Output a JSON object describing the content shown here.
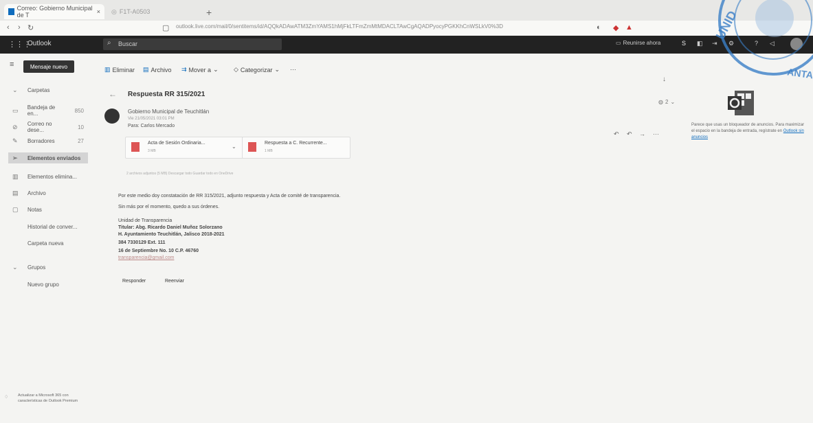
{
  "browser": {
    "tab1_title": "Correo: Gobierno Municipal de T",
    "tab2_title": "F1T-A0503",
    "url": "outlook.live.com/mail/0/sentitems/id/AQQkADAwATM3ZmYAMS1hMjFkLTFmZmMtMDACLTAwCgAQADPyocyPGKKhCnWSLkV0%3D"
  },
  "outlook": {
    "title": "Outlook",
    "search_placeholder": "Buscar",
    "meeting_label": "Reunirse ahora"
  },
  "toolbar": {
    "new_message": "Mensaje nuevo",
    "delete": "Eliminar",
    "archive": "Archivo",
    "move_to": "Mover a",
    "categorize": "Categorizar"
  },
  "sidebar": {
    "folders_header": "Carpetas",
    "items": [
      {
        "label": "Bandeja de en...",
        "count": "850"
      },
      {
        "label": "Correo no dese...",
        "count": "10"
      },
      {
        "label": "Borradores",
        "count": "27"
      },
      {
        "label": "Elementos enviados",
        "count": ""
      },
      {
        "label": "Elementos elimina...",
        "count": ""
      },
      {
        "label": "Archivo",
        "count": ""
      },
      {
        "label": "Notas",
        "count": ""
      },
      {
        "label": "Historial de conver...",
        "count": ""
      },
      {
        "label": "Carpeta nueva",
        "count": ""
      }
    ],
    "groups_header": "Grupos",
    "new_group": "Nuevo grupo",
    "upgrade": "Actualizar a Microsoft 365 con características de Outlook Premium"
  },
  "email": {
    "subject": "Respuesta RR 315/2021",
    "sender": "Gobierno Municipal de Teuchitlán",
    "date": "Vie 21/05/2021 03:01 PM",
    "to": "Para: Carlos Mercado",
    "count_badge": "2",
    "attachments": [
      {
        "name": "Acta de Sesión Ordinaria...",
        "size": "3 MB"
      },
      {
        "name": "Respuesta a C. Recurrente...",
        "size": "1 MB"
      }
    ],
    "attachment_actions": "2 archivos adjuntos (5 MB)   Descargar todo   Guardar todo en OneDrive",
    "body_line1": "Por este medio doy constatación de RR 315/2021, adjunto respuesta y Acta de comité de transparencia.",
    "body_line2": "Sin más por el momento, quedo a sus órdenes.",
    "signature": [
      "Unidad de Transparencia",
      "Titular: Abg. Ricardo Daniel Muñoz Solorzano",
      "H. Ayuntamiento Teuchitlán, Jalisco 2018-2021",
      "384 7330129 Ext. 111",
      "16 de Septiembre No. 10 C.P. 46760",
      "transparencia@gmail.com"
    ],
    "reply": "Responder",
    "forward": "Reenviar"
  },
  "ad": {
    "text": "Parece que usas un bloqueador de anuncios. Para maximizar el espacio en la bandeja de entrada, regístrate en ",
    "link": "Outlook sin anuncios"
  },
  "colors": {
    "topbar": "#222222",
    "accent": "#0f6cbd",
    "selected": "#d4d4d4"
  }
}
